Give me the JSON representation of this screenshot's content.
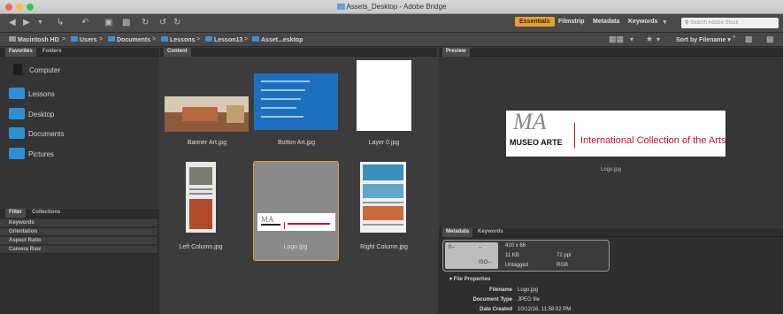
{
  "window": {
    "title": "Assets_Desktop - Adobe Bridge"
  },
  "workspaces": [
    "Essentials",
    "Filmstrip",
    "Metadata",
    "Keywords"
  ],
  "search": {
    "placeholder": "Search Adobe Stock"
  },
  "sort": {
    "label": "Sort by Filename"
  },
  "path": [
    "Macintosh HD",
    "Users",
    "Documents",
    "Lessons",
    "Lesson13",
    "Asset...esktop"
  ],
  "tabs": {
    "favorites": "Favorites",
    "folders": "Folders",
    "content": "Content",
    "preview": "Preview",
    "filter": "Filter",
    "collections": "Collections",
    "metadata": "Metadata",
    "keywords": "Keywords"
  },
  "favorites": [
    "Computer",
    "Lessons",
    "Desktop",
    "Documents",
    "Pictures"
  ],
  "filters": [
    "Keywords",
    "Orientation",
    "Aspect Ratio",
    "Camera Raw"
  ],
  "thumbnails": [
    "Banner Art.jpg",
    "Button Art.jpg",
    "Layer 0.jpg",
    "Left Column.jpg",
    "Logo.jpg",
    "Right Column.jpg"
  ],
  "logo": {
    "brand": "MUSEO ARTE",
    "tagline": "International Collection of the Arts",
    "mark": "MA"
  },
  "preview": {
    "caption": "Logo.jpg"
  },
  "metadata_summary": {
    "dims": "410 x 68",
    "size": "11 KB",
    "ppi": "72 ppi",
    "tag": "Untagged",
    "mode": "RGB",
    "cam1": "f/--",
    "cam2": "--",
    "cam3": "ISO--"
  },
  "file_properties": {
    "heading": "File Properties",
    "rows": [
      {
        "k": "Filename",
        "v": "Logo.jpg"
      },
      {
        "k": "Document Type",
        "v": "JPEG file"
      },
      {
        "k": "Date Created",
        "v": "10/12/16, 11:58:02 PM"
      }
    ]
  },
  "colors": {
    "accent": "#e8a12c",
    "folder": "#2f8fd6",
    "logo_red": "#c8102e"
  }
}
